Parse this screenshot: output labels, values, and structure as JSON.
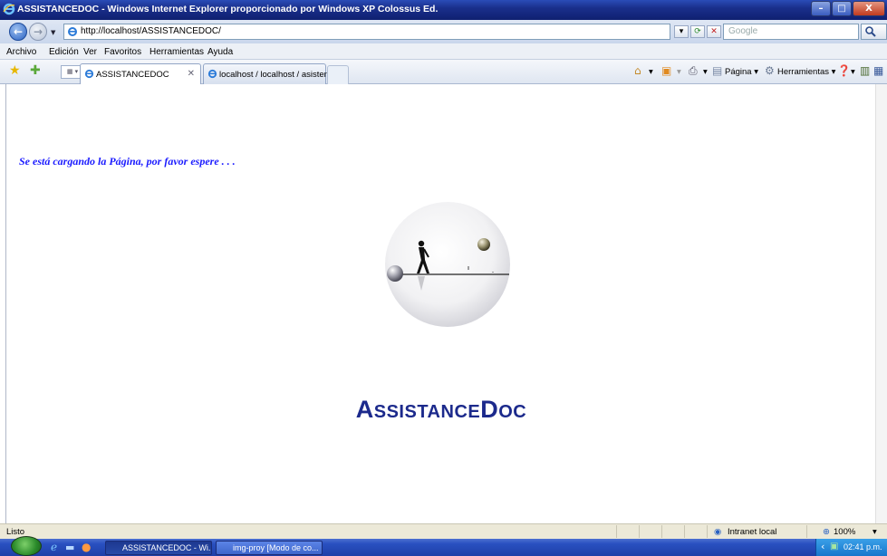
{
  "window": {
    "title": "ASSISTANCEDOC - Windows Internet Explorer proporcionado por Windows XP Colossus Ed.",
    "minimize": "–",
    "maximize": "□",
    "close": "X"
  },
  "address_bar": {
    "url": "http://localhost/ASSISTANCEDOC/",
    "search_placeholder": "Google"
  },
  "menu": [
    "Archivo",
    "Edición",
    "Ver",
    "Favoritos",
    "Herramientas",
    "Ayuda"
  ],
  "tabs": [
    {
      "label": "ASSISTANCEDOC",
      "active": true
    },
    {
      "label": "localhost / localhost / asisten...",
      "active": false
    }
  ],
  "command_bar": {
    "page_label": "Página",
    "tools_label": "Herramientas"
  },
  "page": {
    "loading_message": "Se está cargando la Página, por favor espere . . .",
    "brand_first": "A",
    "brand_mid": "SSISTANCE",
    "brand_d": "D",
    "brand_end": "OC"
  },
  "status_bar": {
    "status": "Listo",
    "zone": "Intranet local",
    "zoom": "100%"
  },
  "taskbar": {
    "items": [
      {
        "label": "ASSISTANCEDOC - Wi...",
        "active": true
      },
      {
        "label": "img-proy [Modo de co...",
        "active": false
      }
    ],
    "clock": "02:41 p.m."
  },
  "colors": {
    "loading_text": "#1a1aff",
    "brand_text": "#1c2a8c"
  }
}
